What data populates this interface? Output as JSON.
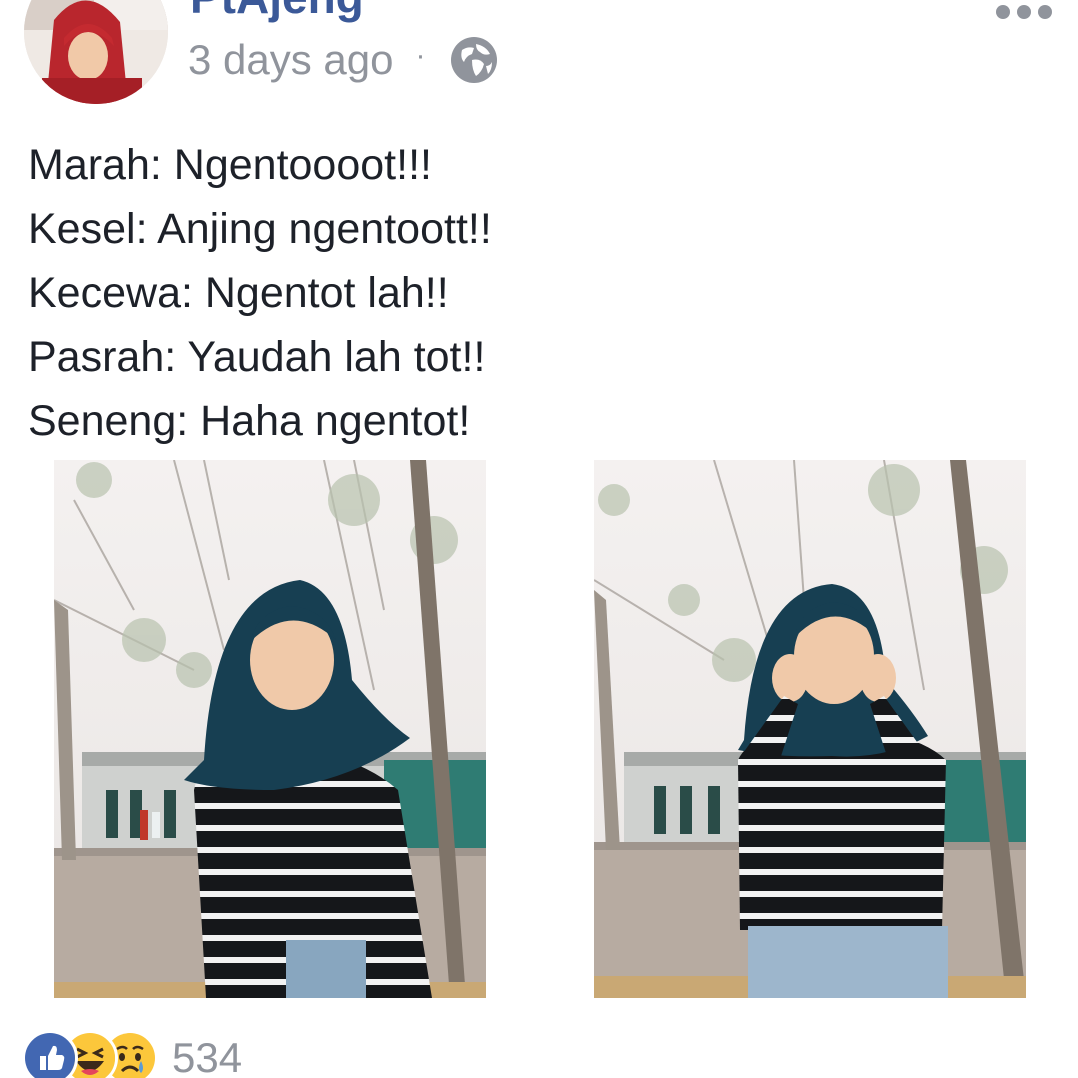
{
  "post": {
    "author": "PtAjeng",
    "time": "3 days ago",
    "separator": "·",
    "privacy_icon": "globe-icon",
    "more_icon": "more-options-icon",
    "lines": [
      "Marah: Ngentoooot!!!",
      "Kesel: Anjing ngentoott!!",
      "Kecewa: Ngentot lah!!",
      "Pasrah: Yaudah lah tot!!",
      "Seneng: Haha ngentot!"
    ]
  },
  "photos": [
    {
      "name": "photo-1"
    },
    {
      "name": "photo-2"
    }
  ],
  "reactions": {
    "icons": [
      "like-icon",
      "haha-icon",
      "sad-icon"
    ],
    "count": "534",
    "colors": {
      "like": "#4267b2",
      "haha": "#fcc73b",
      "sad": "#fcc73b",
      "meta": "#90949c",
      "name": "#3b5998"
    }
  }
}
